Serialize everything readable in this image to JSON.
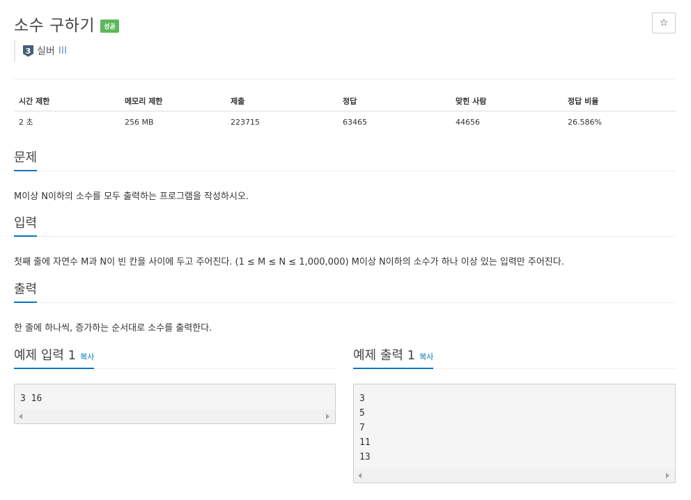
{
  "problem": {
    "title": "소수 구하기",
    "status_badge": "성공",
    "star_icon": "☆",
    "tier_number": "3",
    "tier_name": "실버",
    "tier_level": "III"
  },
  "stats": {
    "headers": [
      "시간 제한",
      "메모리 제한",
      "제출",
      "정답",
      "맞힌 사람",
      "정답 비율"
    ],
    "values": [
      "2 초",
      "256 MB",
      "223715",
      "63465",
      "44656",
      "26.586%"
    ]
  },
  "sections": {
    "problem_heading": "문제",
    "problem_text": "M이상 N이하의 소수를 모두 출력하는 프로그램을 작성하시오.",
    "input_heading": "입력",
    "input_text": "첫째 줄에 자연수 M과 N이 빈 칸을 사이에 두고 주어진다. (1 ≤ M ≤ N ≤ 1,000,000) M이상 N이하의 소수가 하나 이상 있는 입력만 주어진다.",
    "output_heading": "출력",
    "output_text": "한 줄에 하나씩, 증가하는 순서대로 소수를 출력한다."
  },
  "samples": {
    "input_heading": "예제 입력 1",
    "output_heading": "예제 출력 1",
    "copy_label": "복사",
    "input_value": "3 16",
    "output_value": "3\n5\n7\n11\n13"
  },
  "colors": {
    "accent": "#0076c0",
    "badge_success": "#5cb85c",
    "tier_silver": "#435f7a"
  }
}
